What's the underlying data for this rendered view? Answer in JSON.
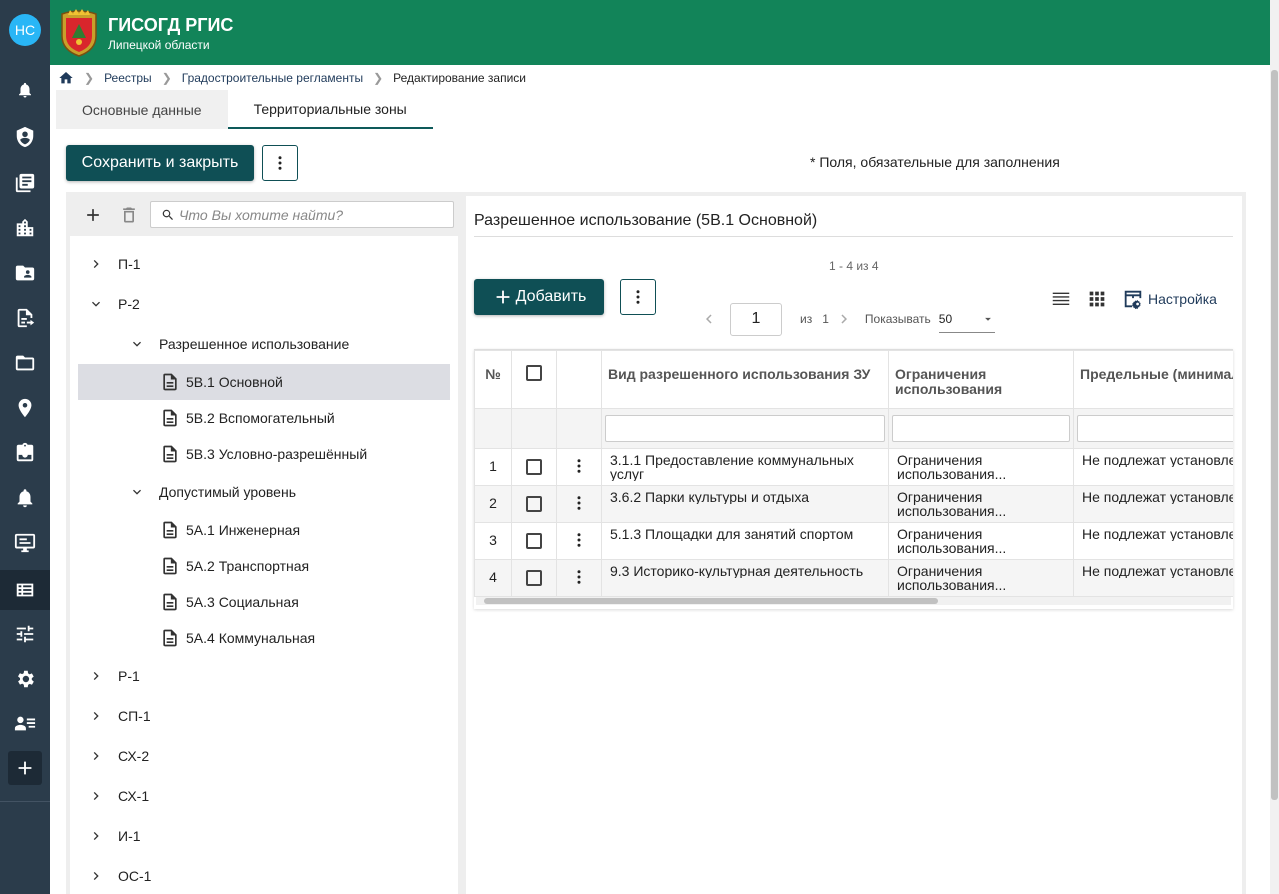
{
  "user": {
    "initials": "НС"
  },
  "app": {
    "title": "ГИСОГД РГИС",
    "subtitle": "Липецкой области"
  },
  "colors": {
    "header": "#128459",
    "rail": "#2b3c4b",
    "primary_button": "#0f4f55",
    "selected_row": "#dcdde3"
  },
  "breadcrumb": {
    "items": [
      "Реестры",
      "Градостроительные регламенты"
    ],
    "current": "Редактирование записи"
  },
  "tabs": [
    {
      "label": "Основные данные"
    },
    {
      "label": "Территориальные зоны"
    }
  ],
  "toolbar": {
    "save_label": "Сохранить и закрыть",
    "required_note": "* Поля, обязательные для заполнения"
  },
  "tree": {
    "search_placeholder": "Что Вы хотите найти?",
    "nodes": {
      "p1": "П-1",
      "r2": "Р-2",
      "permitted": "Разрешенное использование",
      "v1": "5В.1 Основной",
      "v2": "5В.2 Вспомогательный",
      "v3": "5В.3 Условно-разрешённый",
      "level": "Допустимый уровень",
      "a1": "5А.1 Инженерная",
      "a2": "5А.2 Транспортная",
      "a3": "5А.3 Социальная",
      "a4": "5А.4 Коммунальная",
      "r1": "Р-1",
      "sp1": "СП-1",
      "sh2": "СХ-2",
      "sh1": "СХ-1",
      "i1": "И-1",
      "os1": "ОС-1"
    }
  },
  "panel": {
    "title": "Разрешенное использование (5В.1 Основной)",
    "range": "1 - 4 из 4",
    "add_label": "Добавить",
    "settings_label": "Настройка",
    "pager": {
      "page": "1",
      "of_label": "из",
      "total": "1",
      "show_label": "Показывать",
      "page_size": "50"
    }
  },
  "grid": {
    "columns": {
      "num": "№",
      "type": "Вид разрешенного использования ЗУ",
      "limits": "Ограничения использования",
      "params": "Предельные (минимальные и..."
    },
    "rows": [
      {
        "n": "1",
        "type": "3.1.1 Предоставление коммунальных услуг",
        "limits": "Ограничения использования...",
        "params": "Не подлежат установлению"
      },
      {
        "n": "2",
        "type": "3.6.2 Парки культуры и отдыха",
        "limits": "Ограничения использования...",
        "params": "Не подлежат установлению"
      },
      {
        "n": "3",
        "type": "5.1.3 Площадки для занятий спортом",
        "limits": "Ограничения использования...",
        "params": "Не подлежат установлению"
      },
      {
        "n": "4",
        "type": "9.3 Историко-культурная деятельность",
        "limits": "Ограничения использования...",
        "params": "Не подлежат установлению"
      }
    ]
  }
}
